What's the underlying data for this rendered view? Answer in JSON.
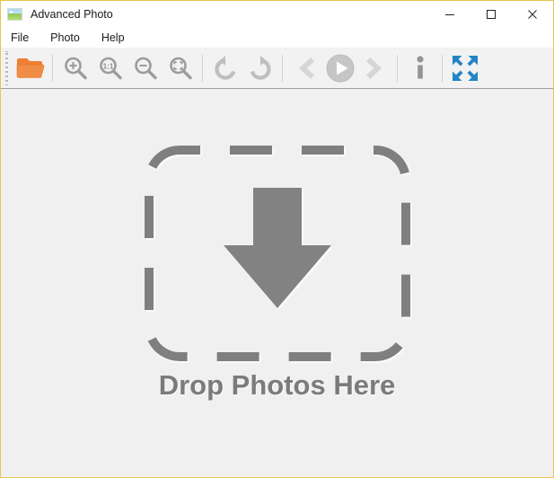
{
  "window": {
    "title": "Advanced Photo",
    "icon": "photo-landscape-icon",
    "border_color": "#e8c54a",
    "titlebar_background": "#ffffff",
    "canvas_background": "#f0f0f0"
  },
  "window_controls": [
    {
      "name": "minimize",
      "glyph": "minimize-icon",
      "label": "Minimize"
    },
    {
      "name": "maximize",
      "glyph": "maximize-icon",
      "label": "Maximize"
    },
    {
      "name": "close",
      "glyph": "close-icon",
      "label": "Close"
    }
  ],
  "menubar": {
    "items": [
      {
        "label": "File"
      },
      {
        "label": "Photo"
      },
      {
        "label": "Help"
      }
    ]
  },
  "toolbar": {
    "grip": "toolbar-grip",
    "buttons": [
      {
        "name": "open-folder",
        "icon": "open-folder-icon",
        "label": "Open",
        "color": "#f08034",
        "enabled": true
      },
      {
        "name": "zoom-in",
        "icon": "zoom-in-icon",
        "label": "Zoom In",
        "color": "#9a9a9a",
        "enabled": true
      },
      {
        "name": "zoom-actual",
        "icon": "zoom-one-to-one-icon",
        "label": "Actual Size",
        "color": "#9a9a9a",
        "enabled": true,
        "text": "1:1"
      },
      {
        "name": "zoom-out",
        "icon": "zoom-out-icon",
        "label": "Zoom Out",
        "color": "#9a9a9a",
        "enabled": true
      },
      {
        "name": "zoom-fit",
        "icon": "zoom-fit-icon",
        "label": "Fit to Window",
        "color": "#9a9a9a",
        "enabled": true
      },
      {
        "name": "rotate-left",
        "icon": "rotate-left-icon",
        "label": "Rotate Left",
        "color": "#bdbdbd",
        "enabled": true
      },
      {
        "name": "rotate-right",
        "icon": "rotate-right-icon",
        "label": "Rotate Right",
        "color": "#bdbdbd",
        "enabled": true
      },
      {
        "name": "previous",
        "icon": "chevron-left-icon",
        "label": "Previous",
        "color": "#d4d4d4",
        "enabled": false
      },
      {
        "name": "slideshow-play",
        "icon": "play-circle-icon",
        "label": "Play Slideshow",
        "color": "#c4c4c4",
        "enabled": true
      },
      {
        "name": "next",
        "icon": "chevron-right-icon",
        "label": "Next",
        "color": "#d4d4d4",
        "enabled": false
      },
      {
        "name": "info",
        "icon": "info-icon",
        "label": "Info",
        "color": "#8f8f8f",
        "enabled": true
      },
      {
        "name": "fullscreen",
        "icon": "fullscreen-icon",
        "label": "Full Screen",
        "color": "#2384c6",
        "enabled": true
      }
    ]
  },
  "dropzone": {
    "icon": "drop-arrow-down-icon",
    "label": "Drop Photos Here",
    "stroke_color": "#808080",
    "arrow_color": "#838383"
  }
}
